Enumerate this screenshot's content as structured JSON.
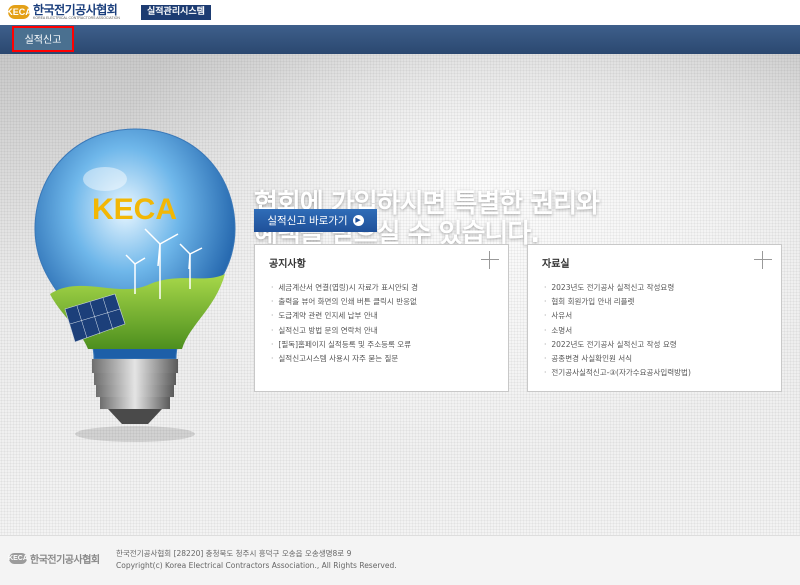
{
  "header": {
    "logo_mark": "KECA",
    "logo_title": "한국전기공사협회",
    "logo_subtitle": "KOREA ELECTRICAL CONTRACTORS ASSOCIATION",
    "system_badge": "실적관리시스템"
  },
  "nav": {
    "items": [
      {
        "label": "실적신고"
      }
    ]
  },
  "hero": {
    "headline_line1": "협회에 가입하시면 특별한 권리와",
    "headline_line2": "혜택을 받으실 수 있습니다.",
    "bulb_logo": "KECA",
    "cta_label": "실적신고 바로가기"
  },
  "notice": {
    "title": "공지사항",
    "items": [
      "세금계산서 연결(엽링)시 자료가 표시안되 경",
      "출력을 뷰어 화면의 인쇄 버튼 클릭시 반응없",
      "도급계약 관련 인지세 납부 안내",
      "실적신고 방법 문의 연락처 안내",
      "[필독]홈페이지 실적등록 및 주소등록 오류",
      "실적신고시스템 사용시 자주 묻는 질문"
    ]
  },
  "data_room": {
    "title": "자료실",
    "items": [
      "2023년도 전기공사 실적신고 작성요령",
      "협회 회원가입 안내 리플렛",
      "사유서",
      "소명서",
      "2022년도 전기공사 실적신고 작성 요령",
      "공종변경 사실확인원 서식",
      "전기공사실적신고-③(자가수요공사입력방법)"
    ]
  },
  "footer": {
    "logo_mark": "KECA",
    "logo_title": "한국전기공사협회",
    "address": "한국전기공사협회 [28220] 충청북도 청주시 흥덕구 오송읍 오송생명8로 9",
    "copyright": "Copyright(c) Korea Electrical Contractors Association., All Rights Reserved."
  },
  "colors": {
    "header_blue": "#1d3c72",
    "nav_bar": "#2b4870",
    "nav_highlight": "#ff0000",
    "cta_blue": "#1f5099",
    "logo_gold": "#e4a017"
  }
}
